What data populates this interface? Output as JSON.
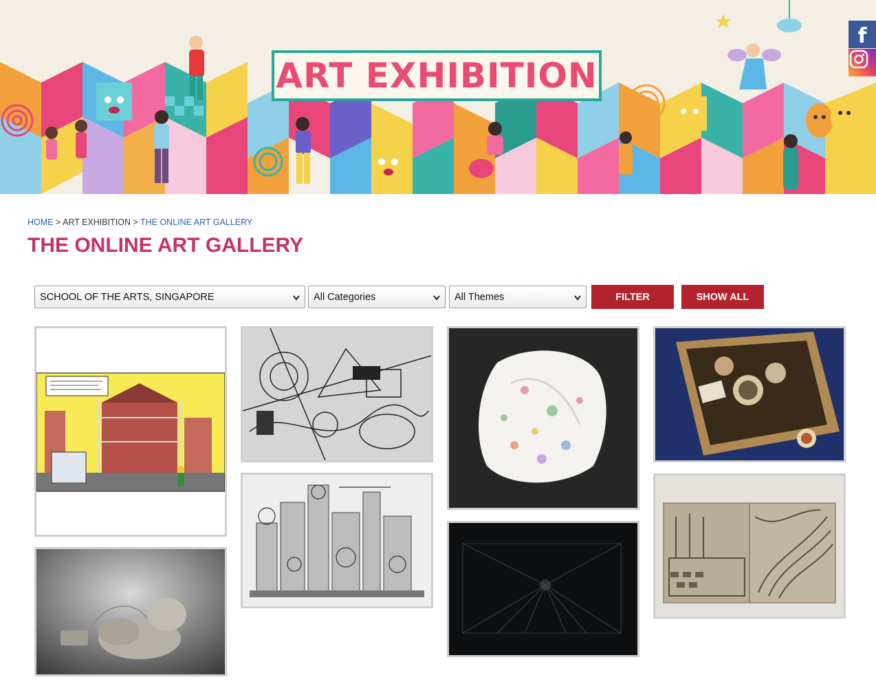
{
  "banner": {
    "title": "ART EXHIBITION",
    "colors": {
      "accent_pink": "#e94b72",
      "teal": "#2aa79b",
      "background": "#f3efe4"
    }
  },
  "social": [
    {
      "name": "facebook-icon",
      "glyph": "f"
    },
    {
      "name": "instagram-icon"
    }
  ],
  "breadcrumb": {
    "home": "HOME",
    "sep1": " > ",
    "art_exhibition": "ART EXHIBITION",
    "sep2": " > ",
    "current": "THE ONLINE ART GALLERY"
  },
  "page_title": "THE ONLINE ART GALLERY",
  "filters": {
    "school": "SCHOOL OF THE ARTS, SINGAPORE",
    "category": "All Categories",
    "theme": "All Themes",
    "filter_label": "FILTER",
    "show_all_label": "SHOW ALL"
  },
  "gallery": [
    {
      "name": "artwork-comic-street-scene"
    },
    {
      "name": "artwork-pencil-abstract-drawing"
    },
    {
      "name": "artwork-floral-fabric-sculpture"
    },
    {
      "name": "artwork-marbles-in-box-painting"
    },
    {
      "name": "artwork-ceramic-figure-with-cord"
    },
    {
      "name": "artwork-mechanical-city-drawing"
    },
    {
      "name": "artwork-dark-line-diagram"
    },
    {
      "name": "artwork-relief-tile-sculpture"
    }
  ]
}
